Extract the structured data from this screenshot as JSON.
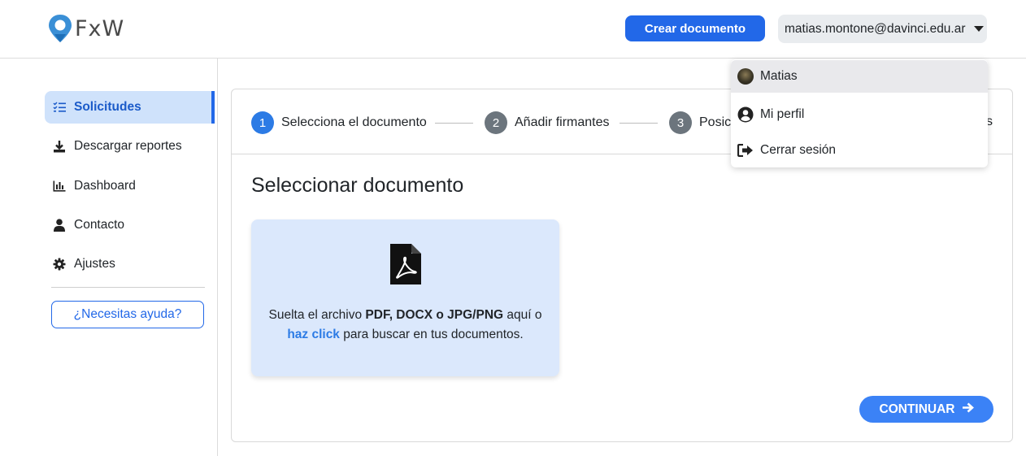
{
  "header": {
    "logo_text": "FxW",
    "create_button": "Crear documento",
    "user_email": "matias.montone@davinci.edu.ar"
  },
  "sidebar": {
    "items": [
      {
        "label": "Solicitudes",
        "icon": "list-check-icon",
        "active": true
      },
      {
        "label": "Descargar reportes",
        "icon": "download-icon",
        "active": false
      },
      {
        "label": "Dashboard",
        "icon": "chart-bar-icon",
        "active": false
      },
      {
        "label": "Contacto",
        "icon": "user-icon",
        "active": false
      },
      {
        "label": "Ajustes",
        "icon": "gear-icon",
        "active": false
      }
    ],
    "help_button": "¿Necesitas ayuda?"
  },
  "stepper": {
    "steps": [
      {
        "number": "1",
        "label": "Selecciona el documento",
        "active": true
      },
      {
        "number": "2",
        "label": "Añadir firmantes",
        "active": false
      },
      {
        "number": "3",
        "label": "Posici",
        "active": false
      }
    ],
    "hidden_tail": "s"
  },
  "main": {
    "title": "Seleccionar documento",
    "dropzone": {
      "icon": "file-pdf-icon",
      "text_before": "Suelta el archivo ",
      "formats": "PDF, DOCX o JPG/PNG",
      "text_after": " aquí o",
      "link": "haz click",
      "text_end": " para buscar en tus documentos."
    },
    "continue_button": "CONTINUAR",
    "continue_icon": "arrow-right-icon"
  },
  "user_menu": {
    "items": [
      {
        "label": "Matias",
        "icon": "avatar"
      },
      {
        "label": "Mi perfil",
        "icon": "user-circle-icon"
      },
      {
        "label": "Cerrar sesión",
        "icon": "sign-out-icon"
      }
    ]
  },
  "colors": {
    "primary": "#2268e8",
    "active_bg": "#cfe2fb",
    "dropzone_bg": "#dbe8fc",
    "step_active": "#2c7be5",
    "step_inactive": "#6c757d"
  }
}
